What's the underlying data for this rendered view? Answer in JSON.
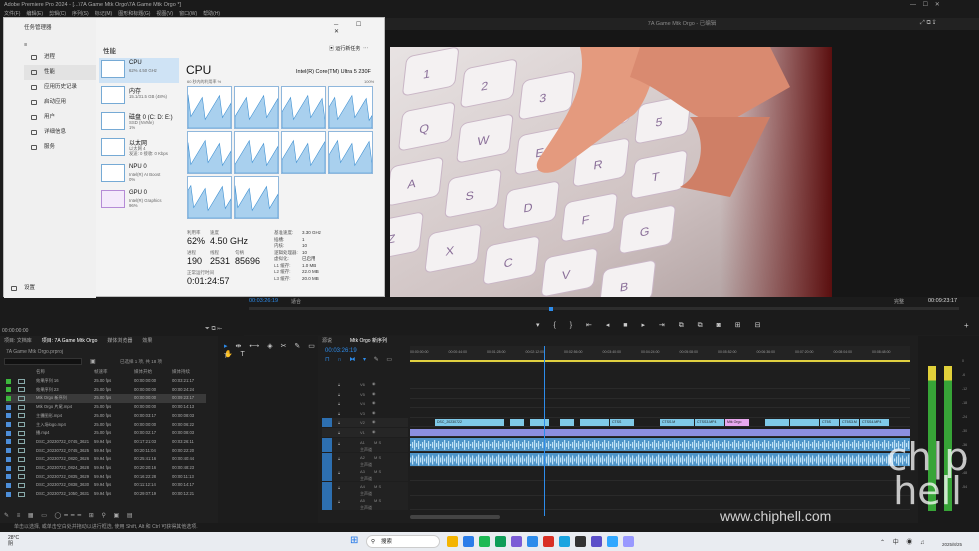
{
  "premiere": {
    "title": "Adobe Premiere Pro 2024 - [...\\7A Game Mtk Orgo\\7A Game Mtk Orgo *]",
    "menu": [
      "文件(F)",
      "编辑(E)",
      "剪辑(C)",
      "序列(S)",
      "标记(M)",
      "图形和标题(G)",
      "视图(V)",
      "窗口(W)",
      "帮助(H)"
    ],
    "tab_title": "7A Game Mtk Orgo - 已编辑",
    "program_timecode": "00:03:26:19",
    "fit_label": "适合",
    "full_label": "完整",
    "program_duration": "00:09:23:17",
    "source_tabs": [
      "项目: 文档库",
      "媒体浏览器",
      "库",
      "信息"
    ],
    "project": {
      "tabs": [
        "项目: 文档库",
        "项目: 7A Game Mtk Orgo",
        "媒体浏览器",
        "效果"
      ],
      "file": "7A Game Mtk Orgo.prproj",
      "search_placeholder": "",
      "item_count": "已选择 1 项, 共 18 项",
      "headers": [
        "名称",
        "帧速率",
        "媒体开始",
        "媒体持续"
      ],
      "rows": [
        {
          "color": "#3db83d",
          "name": "效果序列 16",
          "fps": "25.00 fps",
          "start": "00:00:00:00",
          "dur": "00:03:21:17"
        },
        {
          "color": "#3db83d",
          "name": "效果序列 23",
          "fps": "25.00 fps",
          "start": "00:00:00:00",
          "dur": "00:00:24:24"
        },
        {
          "color": "#3db83d",
          "name": "Mtk Orgo 新序列",
          "fps": "25.00 fps",
          "start": "00:00:00:00",
          "dur": "00:09:23:17"
        },
        {
          "color": "#4d8ed9",
          "name": "Mtk Orgo 片尾.mp4",
          "fps": "25.00 fps",
          "start": "00:00:00:00",
          "dur": "00:00:14:13"
        },
        {
          "color": "#4d8ed9",
          "name": "主摄图形.mp4",
          "fps": "25.00 fps",
          "start": "00:00:03:17",
          "dur": "00:00:08:03"
        },
        {
          "color": "#4d8ed9",
          "name": "主入场logo.mp4",
          "fps": "25.00 fps",
          "start": "00:00:00:00",
          "dur": "00:00:06:22"
        },
        {
          "color": "#4d8ed9",
          "name": "播.mp4",
          "fps": "25.00 fps",
          "start": "00:00:02:17",
          "dur": "00:00:08:03"
        },
        {
          "color": "#4d8ed9",
          "name": "DSC_20230722_0745_3621",
          "fps": "59.94 fps",
          "start": "00:17:21:03",
          "dur": "00:03:26:11"
        },
        {
          "color": "#4d8ed9",
          "name": "DSC_20230722_0745_3625",
          "fps": "59.94 fps",
          "start": "00:20:11:04",
          "dur": "00:00:22:20"
        },
        {
          "color": "#4d8ed9",
          "name": "DSC_20230722_0820_3626",
          "fps": "59.94 fps",
          "start": "00:25:41:16",
          "dur": "00:00:40:44"
        },
        {
          "color": "#4d8ed9",
          "name": "DSC_20230722_0824_3628",
          "fps": "59.94 fps",
          "start": "00:20:20:16",
          "dur": "00:00:48:23"
        },
        {
          "color": "#4d8ed9",
          "name": "DSC_20230722_0835_3629",
          "fps": "59.94 fps",
          "start": "00:16:22:28",
          "dur": "00:00:11:13"
        },
        {
          "color": "#4d8ed9",
          "name": "DSC_20230722_0838_3630",
          "fps": "59.94 fps",
          "start": "00:11:12:14",
          "dur": "00:00:14:17"
        },
        {
          "color": "#4d8ed9",
          "name": "DSC_20230722_1050_3631",
          "fps": "59.94 fps",
          "start": "00:29:07:19",
          "dur": "00:00:12:21"
        }
      ]
    },
    "timeline": {
      "tabs": [
        "源说",
        "Mtk Orgo 新序列"
      ],
      "timecode": "00:03:26:19",
      "ruler": [
        "00:00:00:00",
        "00:00:44:00",
        "00:01:28:00",
        "00:02:12:00",
        "00:02:56:00",
        "00:03:40:00",
        "00:04:24:00",
        "00:05:08:00",
        "00:05:52:00",
        "00:06:36:00",
        "00:07:20:00",
        "00:08:04:00",
        "00:08:48:00"
      ],
      "video_tracks": [
        "V6",
        "V5",
        "V4",
        "V3",
        "V2",
        "V1"
      ],
      "audio_tracks": [
        "A1",
        "A2",
        "A3",
        "A4",
        "A5"
      ],
      "master_label": "主声道",
      "mix_value": "0.0",
      "v2_clips": [
        {
          "label": "DSC_20230722",
          "start": 0.05,
          "end": 0.19,
          "color": "#7fc9e8"
        },
        {
          "label": "",
          "start": 0.2,
          "end": 0.23,
          "color": "#7fc9e8"
        },
        {
          "label": "",
          "start": 0.24,
          "end": 0.28,
          "color": "#7fc9e8"
        },
        {
          "label": "",
          "start": 0.3,
          "end": 0.33,
          "color": "#7fc9e8"
        },
        {
          "label": "",
          "start": 0.34,
          "end": 0.4,
          "color": "#7fc9e8"
        },
        {
          "label": "CTSS",
          "start": 0.4,
          "end": 0.45,
          "color": "#7fc9e8"
        },
        {
          "label": "CTSS.M",
          "start": 0.5,
          "end": 0.57,
          "color": "#7fc9e8"
        },
        {
          "label": "CTSS3.MP4",
          "start": 0.57,
          "end": 0.63,
          "color": "#7fc9e8"
        },
        {
          "label": "Mtk Orgo",
          "start": 0.63,
          "end": 0.68,
          "color": "#e7a7ee"
        },
        {
          "label": "",
          "start": 0.71,
          "end": 0.76,
          "color": "#7fc9e8"
        },
        {
          "label": "",
          "start": 0.76,
          "end": 0.82,
          "color": "#7fc9e8"
        },
        {
          "label": "CT5S",
          "start": 0.82,
          "end": 0.86,
          "color": "#7fc9e8"
        },
        {
          "label": "CT5S3.M",
          "start": 0.86,
          "end": 0.9,
          "color": "#7fc9e8"
        },
        {
          "label": "CTSS4.MP4",
          "start": 0.9,
          "end": 0.96,
          "color": "#7fc9e8"
        }
      ]
    },
    "meter_scale": [
      "0",
      "-6",
      "-12",
      "-18",
      "-24",
      "-30",
      "-36",
      "-42",
      "-48",
      "-54"
    ],
    "status_text": "单击以选择, 或单击空白处并拖动以进行框选, 使用 Shift, Alt 和 Ctrl 可获得其他选项."
  },
  "task_manager": {
    "app_title": "任务管理器",
    "nav": [
      "进程",
      "性能",
      "应用历史记录",
      "启动应用",
      "用户",
      "详细信息",
      "服务"
    ],
    "nav_settings": "设置",
    "section_title": "性能",
    "run_task": "运行新任务",
    "devices": [
      {
        "name": "CPU",
        "sub": "62% 4.50 GHz",
        "purple": false
      },
      {
        "name": "内存",
        "sub": "15.1/31.5 GB (48%)",
        "purple": false
      },
      {
        "name": "磁盘 0 (C: D: E:)",
        "sub": "SSD (NVMe)\n1%",
        "purple": false
      },
      {
        "name": "以太网",
        "sub": "以太网 4\n发送: 0 接收: 0 Kbps",
        "purple": false
      },
      {
        "name": "NPU 0",
        "sub": "Intel(R) AI Boost\n0%",
        "purple": false
      },
      {
        "name": "GPU 0",
        "sub": "Intel(R) Graphics\n96%",
        "purple": true
      }
    ],
    "cpu_title": "CPU",
    "cpu_model": "Intel(R) Core(TM) Ultra 5 230F",
    "graph_label": "60 秒内的利用率 %",
    "graph_max": "100%",
    "utilization_label": "利用率",
    "utilization": "62%",
    "speed_label": "速度",
    "speed": "4.50 GHz",
    "processes_label": "进程",
    "processes": "190",
    "threads_label": "线程",
    "threads": "2531",
    "handles_label": "句柄",
    "handles": "85696",
    "uptime_label": "正常运行时间",
    "uptime": "0:01:24:57",
    "specs": [
      [
        "基准速度:",
        "3.30 GHz"
      ],
      [
        "插槽:",
        "1"
      ],
      [
        "内核:",
        "10"
      ],
      [
        "逻辑处理器:",
        "10"
      ],
      [
        "虚拟化:",
        "已启用"
      ],
      [
        "L1 缓存:",
        "1.0 MB"
      ],
      [
        "L2 缓存:",
        "22.0 MB"
      ],
      [
        "L3 缓存:",
        "20.0 MB"
      ]
    ]
  },
  "taskbar": {
    "weather_temp": "28°C",
    "weather_desc": "阴",
    "search_placeholder": "搜索",
    "date": "2025/8/25",
    "watermark_site": "www.chiphell.com",
    "watermark_logo": "chip hell"
  }
}
